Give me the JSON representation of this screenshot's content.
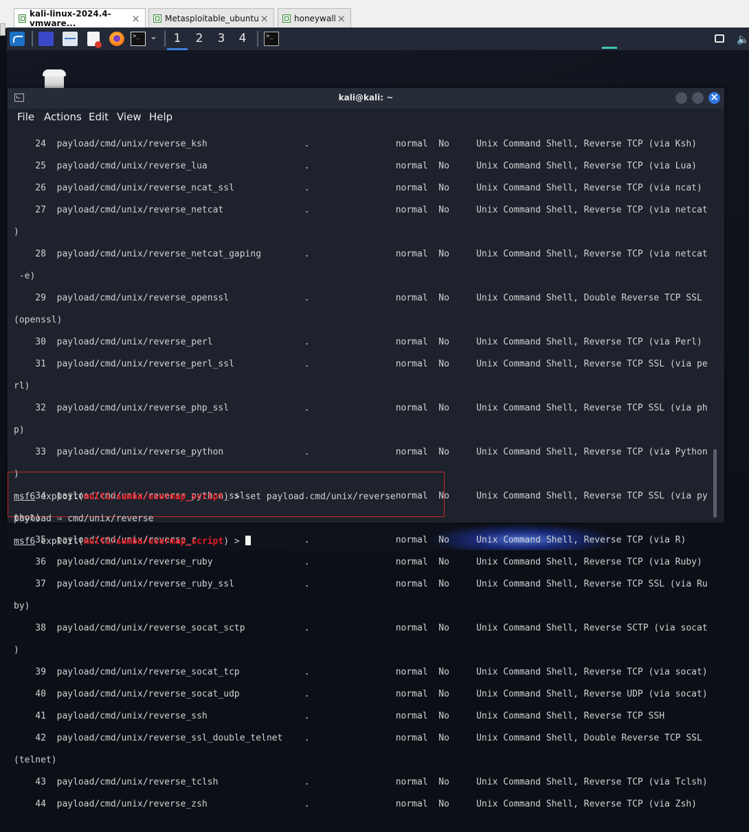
{
  "vmware_tabs": [
    {
      "label": "kali-linux-2024.4-vmware...",
      "active": true
    },
    {
      "label": "Metasploitable_ubuntu",
      "active": false
    },
    {
      "label": "honeywall",
      "active": false
    }
  ],
  "panel": {
    "workspaces": [
      "1",
      "2",
      "3",
      "4"
    ],
    "active_workspace": "1",
    "icons": [
      "kali-menu-icon",
      "workspace-icon",
      "file-manager-icon",
      "text-editor-icon",
      "firefox-icon",
      "terminal-icon",
      "chevron-down-icon",
      "taskbar-terminal-icon",
      "monitor-icon",
      "speaker-icon"
    ]
  },
  "desktop": {
    "trash_icon": "trash-icon"
  },
  "terminal": {
    "title": "kali@kali: ~",
    "menu": [
      "File",
      "Actions",
      "Edit",
      "View",
      "Help"
    ],
    "lines": [
      "    24  payload/cmd/unix/reverse_ksh                  .                normal  No     Unix Command Shell, Reverse TCP (via Ksh)",
      "    25  payload/cmd/unix/reverse_lua                  .                normal  No     Unix Command Shell, Reverse TCP (via Lua)",
      "    26  payload/cmd/unix/reverse_ncat_ssl             .                normal  No     Unix Command Shell, Reverse TCP (via ncat)",
      "    27  payload/cmd/unix/reverse_netcat               .                normal  No     Unix Command Shell, Reverse TCP (via netcat",
      ")",
      "    28  payload/cmd/unix/reverse_netcat_gaping        .                normal  No     Unix Command Shell, Reverse TCP (via netcat",
      " -e)",
      "    29  payload/cmd/unix/reverse_openssl              .                normal  No     Unix Command Shell, Double Reverse TCP SSL",
      "(openssl)",
      "    30  payload/cmd/unix/reverse_perl                 .                normal  No     Unix Command Shell, Reverse TCP (via Perl)",
      "    31  payload/cmd/unix/reverse_perl_ssl             .                normal  No     Unix Command Shell, Reverse TCP SSL (via pe",
      "rl)",
      "    32  payload/cmd/unix/reverse_php_ssl              .                normal  No     Unix Command Shell, Reverse TCP SSL (via ph",
      "p)",
      "    33  payload/cmd/unix/reverse_python               .                normal  No     Unix Command Shell, Reverse TCP (via Python",
      ")",
      "    34  payload/cmd/unix/reverse_python_ssl           .                normal  No     Unix Command Shell, Reverse TCP SSL (via py",
      "thon)",
      "    35  payload/cmd/unix/reverse_r                    .                normal  No     Unix Command Shell, Reverse TCP (via R)",
      "    36  payload/cmd/unix/reverse_ruby                 .                normal  No     Unix Command Shell, Reverse TCP (via Ruby)",
      "    37  payload/cmd/unix/reverse_ruby_ssl             .                normal  No     Unix Command Shell, Reverse TCP SSL (via Ru",
      "by)",
      "    38  payload/cmd/unix/reverse_socat_sctp           .                normal  No     Unix Command Shell, Reverse SCTP (via socat",
      ")",
      "    39  payload/cmd/unix/reverse_socat_tcp            .                normal  No     Unix Command Shell, Reverse TCP (via socat)",
      "    40  payload/cmd/unix/reverse_socat_udp            .                normal  No     Unix Command Shell, Reverse UDP (via socat)",
      "    41  payload/cmd/unix/reverse_ssh                  .                normal  No     Unix Command Shell, Reverse TCP SSH",
      "    42  payload/cmd/unix/reverse_ssl_double_telnet    .                normal  No     Unix Command Shell, Double Reverse TCP SSL",
      "(telnet)",
      "    43  payload/cmd/unix/reverse_tclsh                .                normal  No     Unix Command Shell, Reverse TCP (via Tclsh)",
      "    44  payload/cmd/unix/reverse_zsh                  .                normal  No     Unix Command Shell, Reverse TCP (via Zsh)"
    ],
    "prompt": {
      "msf": "msf6",
      "exploit_open": " exploit(",
      "module": "multi/samba/usermap_script",
      "exploit_close": ") > ",
      "command": "set payload cmd/unix/reverse",
      "result": "payload ⇒ cmd/unix/reverse"
    }
  }
}
